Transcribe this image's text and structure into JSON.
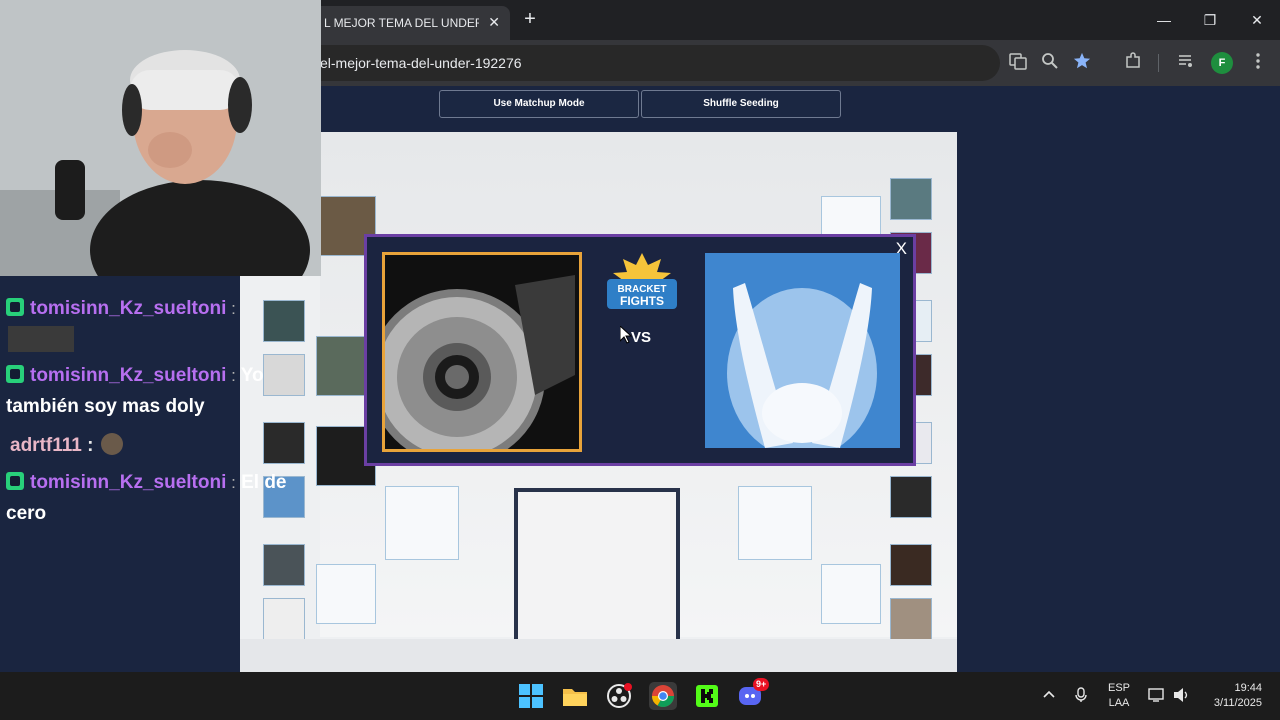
{
  "browser": {
    "tab_title": "L MEJOR TEMA DEL UNDER B",
    "tab_close": "✕",
    "new_tab": "+",
    "url": "el-mejor-tema-del-under-192276",
    "profile_initial": "F",
    "window": {
      "minimize": "—",
      "restore": "❐",
      "close": "✕"
    }
  },
  "controls": {
    "matchup_label": "Use Matchup Mode",
    "shuffle_label": "Shuffle Seeding"
  },
  "modal": {
    "close": "X",
    "vs": "VS",
    "logo_line1": "BRACKET",
    "logo_line2": "FIGHTS"
  },
  "chat": {
    "lines": [
      {
        "user": "tomisinn_Kz_sueltoni",
        "sep": " :",
        "msg": ""
      },
      {
        "user": "tomisinn_Kz_sueltoni",
        "sep": " :",
        "msg": " Yo"
      },
      {
        "cont": "también soy mas doly"
      },
      {
        "user": "adrtf111",
        "sep": " :",
        "msg": ""
      },
      {
        "user": "tomisinn_Kz_sueltoni",
        "sep": " :",
        "msg": " El de"
      },
      {
        "cont": "cero"
      }
    ]
  },
  "taskbar": {
    "lang_top": "ESP",
    "lang_bottom": "LAA",
    "time": "19:44",
    "date": "3/11/2025",
    "discord_badge": "9+"
  },
  "colors": {
    "modal_border": "#6b3fa3",
    "selected_border": "#e8a33a",
    "chat_user": "#b76ff0",
    "chat_badge": "#28d07a"
  }
}
